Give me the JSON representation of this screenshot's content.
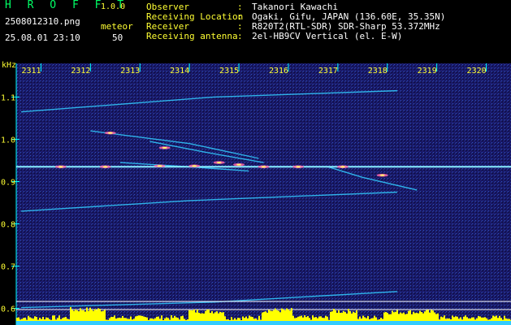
{
  "app": {
    "name": "H R O F F T",
    "version": "1.0.0"
  },
  "file": {
    "name": "2508012310.png",
    "datetime": "25.08.01 23:10"
  },
  "meteor": {
    "label": "meteor",
    "count": "50"
  },
  "meta": [
    {
      "key": "Observer",
      "value": "Takanori Kawachi"
    },
    {
      "key": "Receiving Location",
      "value": "Ogaki, Gifu, JAPAN (136.60E, 35.35N)"
    },
    {
      "key": "Receiver",
      "value": "R820T2(RTL-SDR) SDR-Sharp 53.372MHz"
    },
    {
      "key": "Receiving antenna",
      "value": "2el-HB9CV Vertical (el. E-W)"
    }
  ],
  "colors": {
    "label": "#ffff33",
    "logo": "#00ff66",
    "axis": "#00ffff",
    "background": "#1a1a66",
    "signal": "#33ccff",
    "histogram": "#ffff00"
  },
  "chart_data": {
    "type": "heatmap",
    "ylabel": "kHz",
    "x_ticks": [
      "2311",
      "2312",
      "2313",
      "2314",
      "2315",
      "2316",
      "2317",
      "2318",
      "2319",
      "2320"
    ],
    "y_ticks": [
      "1.1",
      "1.0",
      "0.9",
      "0.8",
      "0.7",
      "0.6"
    ],
    "ylim": [
      0.58,
      1.17
    ],
    "xlim": [
      2310.5,
      2320.5
    ],
    "carrier_khz": 0.935,
    "traces": [
      {
        "x": [
          2310.6,
          2314.5,
          2318.2
        ],
        "y": [
          1.065,
          1.1,
          1.115
        ]
      },
      {
        "x": [
          2310.6,
          2314.0,
          2318.2
        ],
        "y": [
          0.83,
          0.855,
          0.875
        ]
      },
      {
        "x": [
          2312.0,
          2314.0,
          2315.4
        ],
        "y": [
          1.02,
          0.99,
          0.955
        ]
      },
      {
        "x": [
          2313.2,
          2314.3,
          2315.5
        ],
        "y": [
          0.995,
          0.97,
          0.945
        ]
      },
      {
        "x": [
          2312.6,
          2314.0,
          2315.2
        ],
        "y": [
          0.945,
          0.935,
          0.925
        ]
      },
      {
        "x": [
          2316.8,
          2317.5,
          2318.6
        ],
        "y": [
          0.935,
          0.91,
          0.88
        ]
      },
      {
        "x": [
          2310.6,
          2314.5,
          2318.2
        ],
        "y": [
          0.602,
          0.615,
          0.64
        ]
      }
    ],
    "bright_spots": [
      {
        "x": 2311.4,
        "y": 0.935
      },
      {
        "x": 2312.3,
        "y": 0.935
      },
      {
        "x": 2313.4,
        "y": 0.937
      },
      {
        "x": 2314.1,
        "y": 0.937
      },
      {
        "x": 2314.6,
        "y": 0.945
      },
      {
        "x": 2315.0,
        "y": 0.94
      },
      {
        "x": 2315.5,
        "y": 0.935
      },
      {
        "x": 2316.2,
        "y": 0.935
      },
      {
        "x": 2317.1,
        "y": 0.935
      },
      {
        "x": 2317.9,
        "y": 0.915
      },
      {
        "x": 2313.5,
        "y": 0.98
      },
      {
        "x": 2312.4,
        "y": 1.015
      }
    ]
  }
}
